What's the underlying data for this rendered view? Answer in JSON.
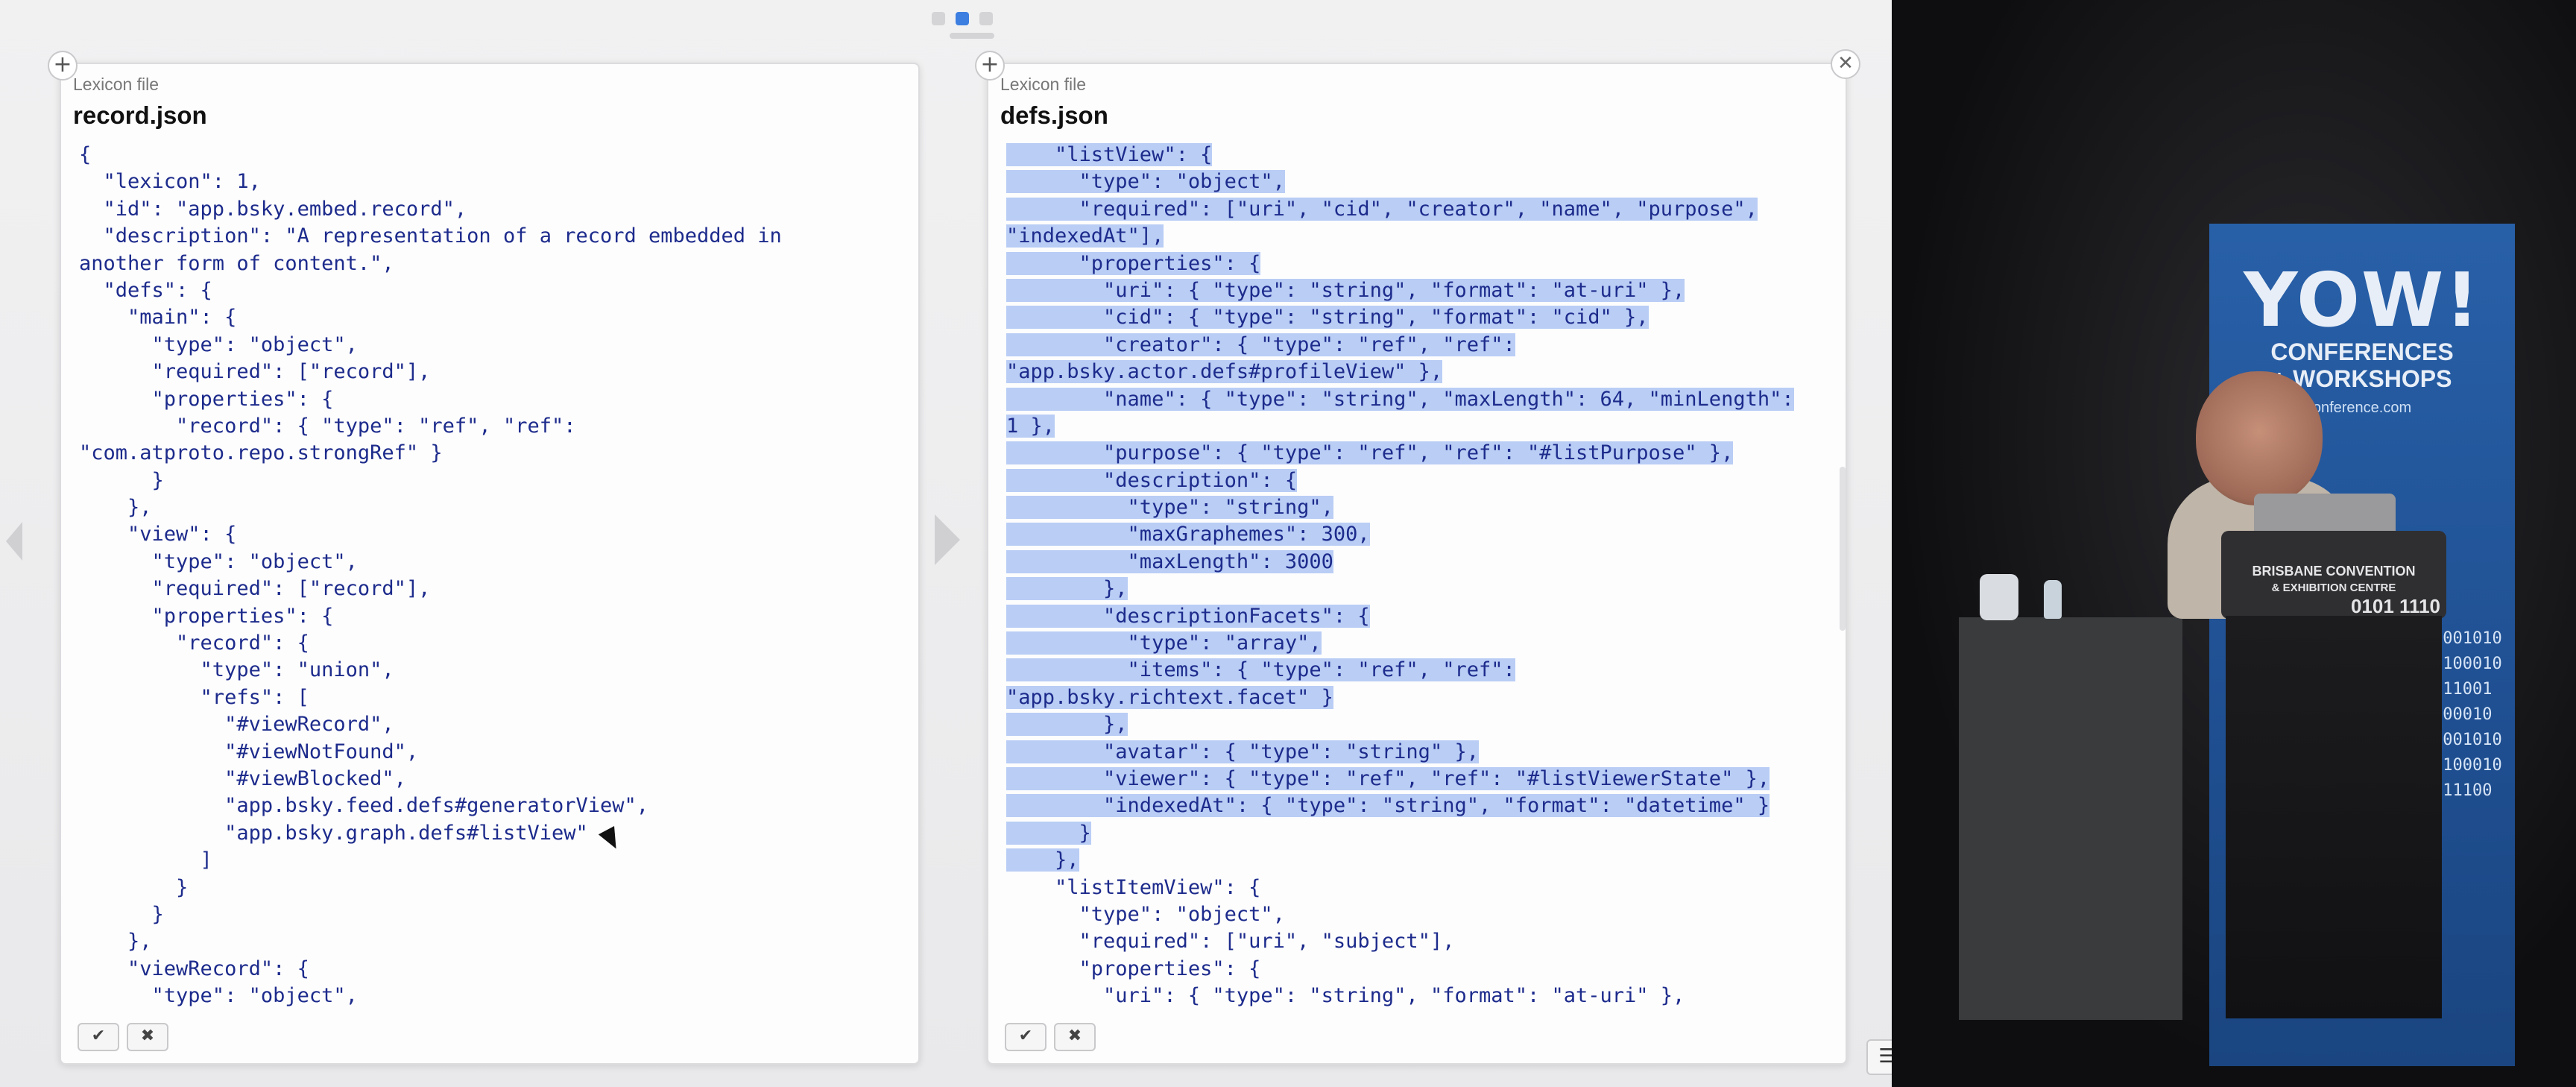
{
  "pager": {
    "dots": 3,
    "active_index": 1
  },
  "left_panel": {
    "label": "Lexicon file",
    "filename": "record.json",
    "code_lines": [
      "{",
      "  \"lexicon\": 1,",
      "  \"id\": \"app.bsky.embed.record\",",
      "  \"description\": \"A representation of a record embedded in",
      "another form of content.\",",
      "  \"defs\": {",
      "    \"main\": {",
      "      \"type\": \"object\",",
      "      \"required\": [\"record\"],",
      "      \"properties\": {",
      "        \"record\": { \"type\": \"ref\", \"ref\":",
      "\"com.atproto.repo.strongRef\" }",
      "      }",
      "    },",
      "    \"view\": {",
      "      \"type\": \"object\",",
      "      \"required\": [\"record\"],",
      "      \"properties\": {",
      "        \"record\": {",
      "          \"type\": \"union\",",
      "          \"refs\": [",
      "            \"#viewRecord\",",
      "            \"#viewNotFound\",",
      "            \"#viewBlocked\",",
      "            \"app.bsky.feed.defs#generatorView\",",
      "            \"app.bsky.graph.defs#listView\"",
      "          ]",
      "        }",
      "      }",
      "    },",
      "    \"viewRecord\": {",
      "      \"type\": \"object\","
    ]
  },
  "right_panel": {
    "label": "Lexicon file",
    "filename": "defs.json",
    "code_lines": [
      "    \"listView\": {",
      "      \"type\": \"object\",",
      "      \"required\": [\"uri\", \"cid\", \"creator\", \"name\", \"purpose\",",
      "\"indexedAt\"],",
      "      \"properties\": {",
      "        \"uri\": { \"type\": \"string\", \"format\": \"at-uri\" },",
      "        \"cid\": { \"type\": \"string\", \"format\": \"cid\" },",
      "        \"creator\": { \"type\": \"ref\", \"ref\":",
      "\"app.bsky.actor.defs#profileView\" },",
      "        \"name\": { \"type\": \"string\", \"maxLength\": 64, \"minLength\":",
      "1 },",
      "        \"purpose\": { \"type\": \"ref\", \"ref\": \"#listPurpose\" },",
      "        \"description\": {",
      "          \"type\": \"string\",",
      "          \"maxGraphemes\": 300,",
      "          \"maxLength\": 3000",
      "        },",
      "        \"descriptionFacets\": {",
      "          \"type\": \"array\",",
      "          \"items\": { \"type\": \"ref\", \"ref\":",
      "\"app.bsky.richtext.facet\" }",
      "        },",
      "        \"avatar\": { \"type\": \"string\" },",
      "        \"viewer\": { \"type\": \"ref\", \"ref\": \"#listViewerState\" },",
      "        \"indexedAt\": { \"type\": \"string\", \"format\": \"datetime\" }",
      "      }",
      "    },",
      "    \"listItemView\": {",
      "      \"type\": \"object\",",
      "      \"required\": [\"uri\", \"subject\"],",
      "      \"properties\": {",
      "        \"uri\": { \"type\": \"string\", \"format\": \"at-uri\" },"
    ],
    "selected_line_count": 27
  },
  "buttons": {
    "ok_glyph": "✔",
    "cancel_glyph": "✖",
    "add_glyph": "+",
    "close_glyph": "✕",
    "menu_glyph": "☰"
  },
  "video": {
    "banner_logo": "YOW!",
    "banner_sub_1": "CONFERENCES",
    "banner_sub_2": "+ WORKSHOPS",
    "banner_url": "onference.com",
    "lectern_line_1": "BRISBANE CONVENTION",
    "lectern_line_2": "& EXHIBITION CENTRE",
    "lectern_digits": "0101 1110",
    "binary_lines": [
      "0001010",
      "1100010",
      "011001",
      "100010",
      "0001010",
      "1100010",
      "011100"
    ]
  },
  "colors": {
    "accent": "#3d7fe0",
    "code_text": "#1d2b8c",
    "selection": "#b9cdf5",
    "banner": "#2860a8"
  }
}
